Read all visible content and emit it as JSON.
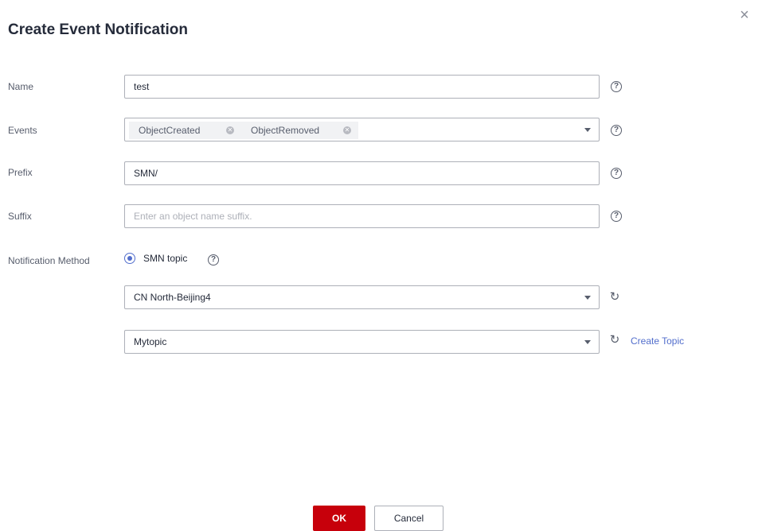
{
  "dialog": {
    "title": "Create Event Notification",
    "close_symbol": "×"
  },
  "form": {
    "name": {
      "label": "Name",
      "value": "test"
    },
    "events": {
      "label": "Events",
      "tags": [
        "ObjectCreated",
        "ObjectRemoved"
      ]
    },
    "prefix": {
      "label": "Prefix",
      "value": "SMN/"
    },
    "suffix": {
      "label": "Suffix",
      "value": "",
      "placeholder": "Enter an object name suffix."
    },
    "notification_method": {
      "label": "Notification Method",
      "option": "SMN topic",
      "selected": true
    },
    "region": {
      "value": "CN North-Beijing4"
    },
    "topic": {
      "value": "Mytopic",
      "create_link": "Create Topic"
    }
  },
  "footer": {
    "ok": "OK",
    "cancel": "Cancel"
  },
  "icons": {
    "help": "question-circle-icon",
    "refresh": "refresh-icon",
    "caret": "chevron-down-icon",
    "tag_remove": "close-circle-icon",
    "close": "close-icon"
  },
  "colors": {
    "accent": "#526ecc",
    "primary_button": "#c7000b",
    "border": "#adb0b8"
  }
}
